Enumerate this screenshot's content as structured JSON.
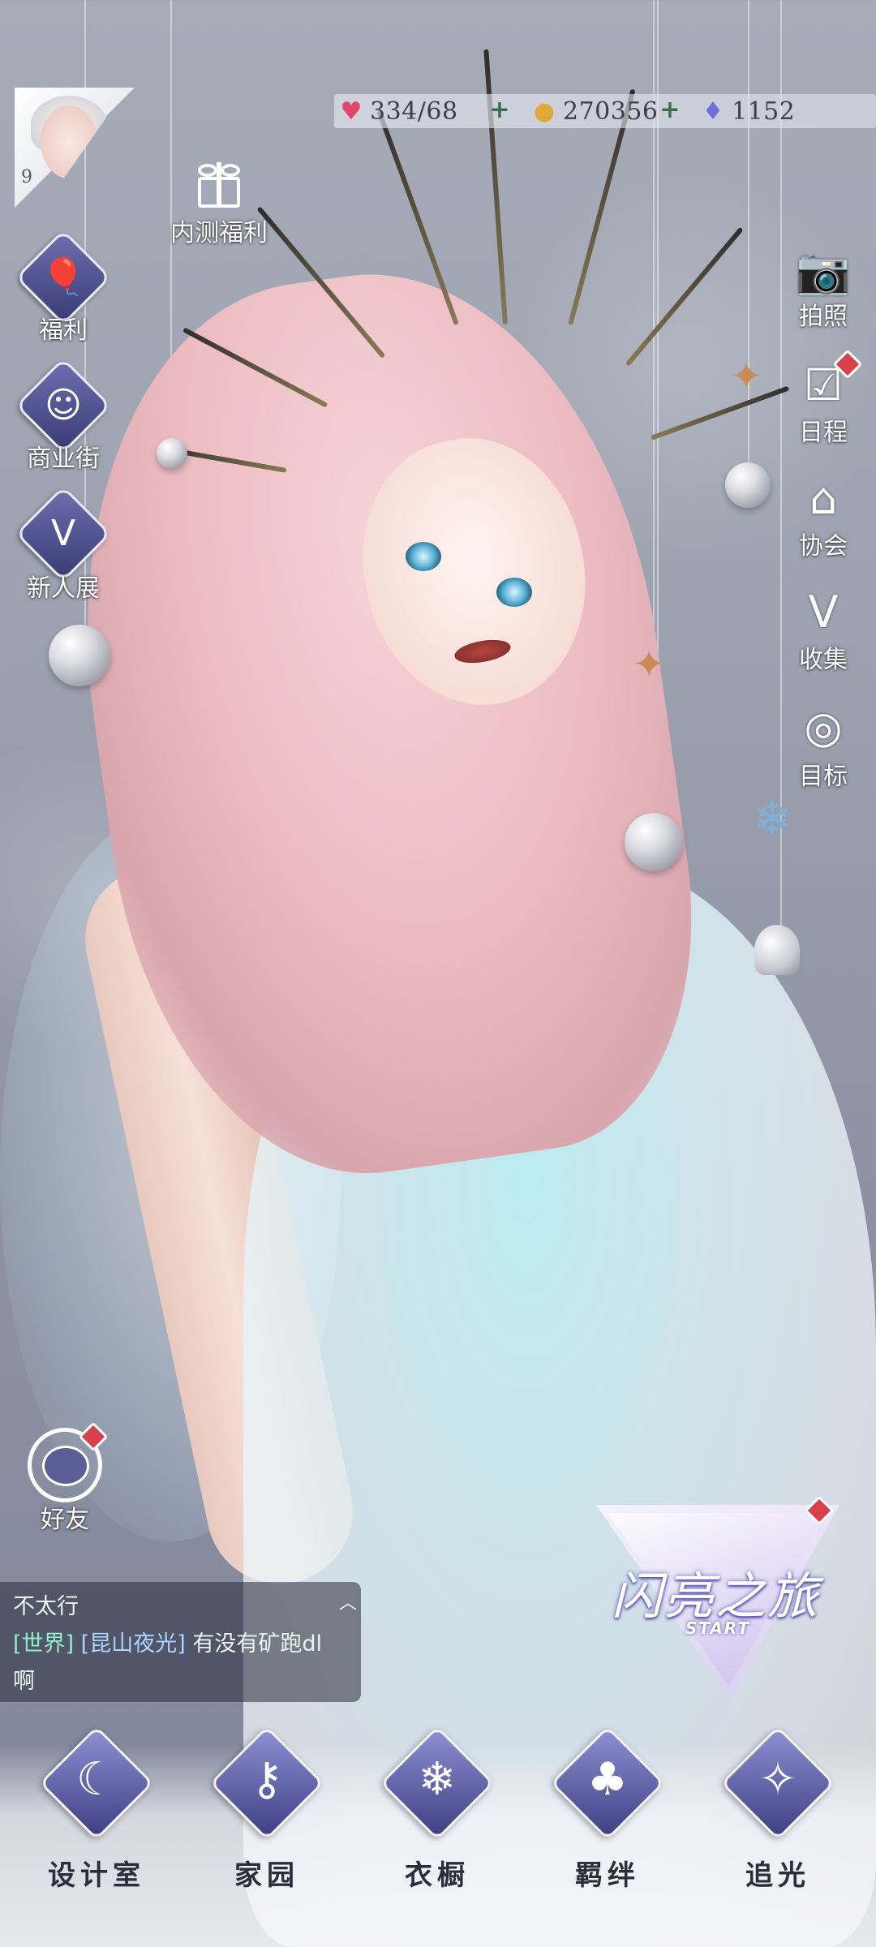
{
  "player": {
    "level": "9"
  },
  "resources": {
    "stamina": "334/68",
    "coins": "270356",
    "diamonds": "1152"
  },
  "left_menu": {
    "beta_reward": "内测福利",
    "welfare": "福利",
    "shopping_street": "商业街",
    "newcomer_exhibit": "新人展",
    "friends": "好友"
  },
  "right_menu": {
    "photo": "拍照",
    "schedule": "日程",
    "association": "协会",
    "collection": "收集",
    "goals": "目标"
  },
  "start_button": {
    "title": "闪亮之旅",
    "subtitle": "START"
  },
  "chat": {
    "line1": "不太行",
    "channel": "[世界]",
    "sender": "[昆山夜光]",
    "message": "有没有矿跑dl",
    "message_cont": "啊"
  },
  "bottom_nav": [
    {
      "label": "设计室",
      "icon": "moon-icon"
    },
    {
      "label": "家园",
      "icon": "key-icon"
    },
    {
      "label": "衣橱",
      "icon": "snowflake-icon"
    },
    {
      "label": "羁绊",
      "icon": "clover-icon"
    },
    {
      "label": "追光",
      "icon": "butterfly-icon"
    }
  ],
  "colors": {
    "badge": "#d8404a",
    "nav_accent": "#3d3f82"
  }
}
